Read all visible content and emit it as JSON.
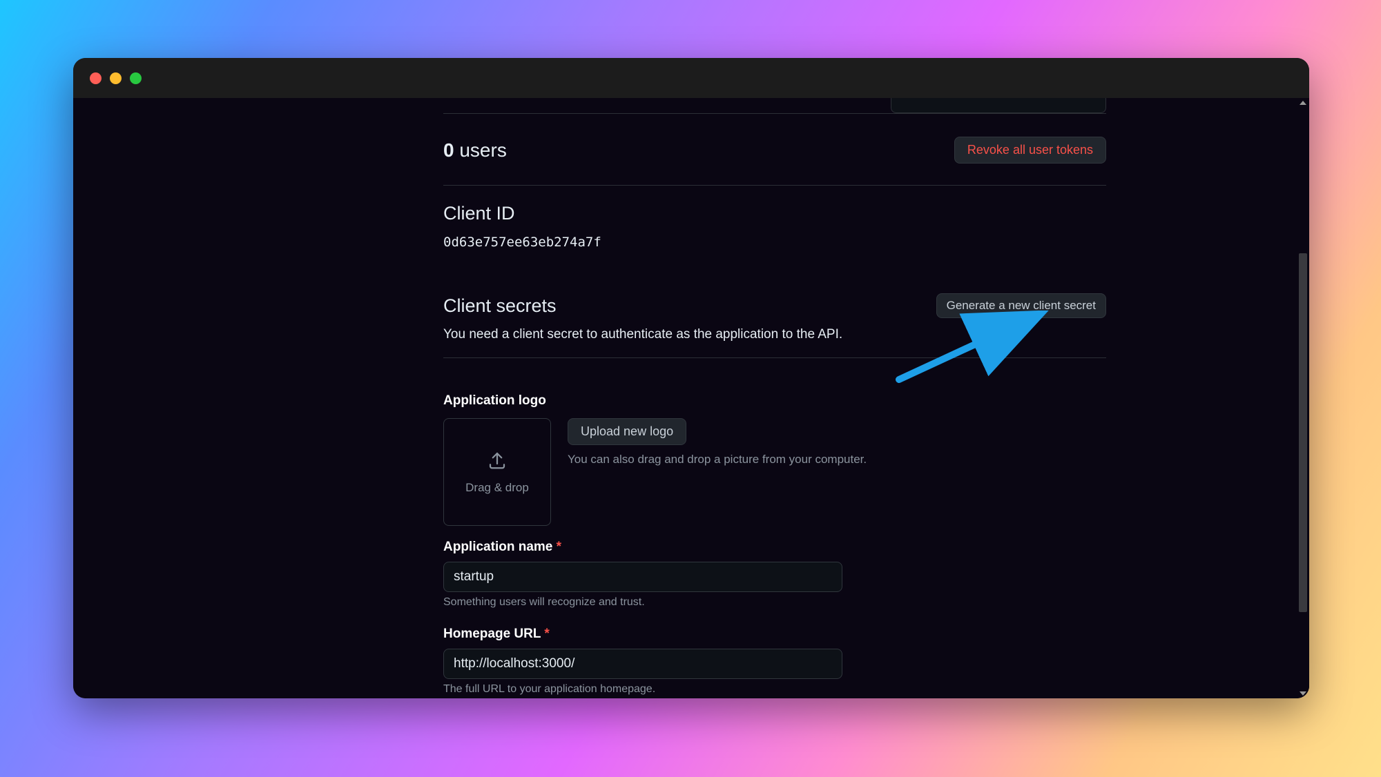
{
  "users": {
    "count": "0",
    "label": "users",
    "revoke_button": "Revoke all user tokens"
  },
  "client_id": {
    "label": "Client ID",
    "value": "0d63e757ee63eb274a7f"
  },
  "client_secrets": {
    "title": "Client secrets",
    "generate_button": "Generate a new client secret",
    "hint": "You need a client secret to authenticate as the application to the API."
  },
  "app_logo": {
    "label": "Application logo",
    "drop_text": "Drag & drop",
    "upload_button": "Upload new logo",
    "upload_hint": "You can also drag and drop a picture from your computer."
  },
  "app_name": {
    "label": "Application name",
    "required": "*",
    "value": "startup",
    "hint": "Something users will recognize and trust."
  },
  "homepage": {
    "label": "Homepage URL",
    "required": "*",
    "value": "http://localhost:3000/",
    "hint": "The full URL to your application homepage."
  }
}
